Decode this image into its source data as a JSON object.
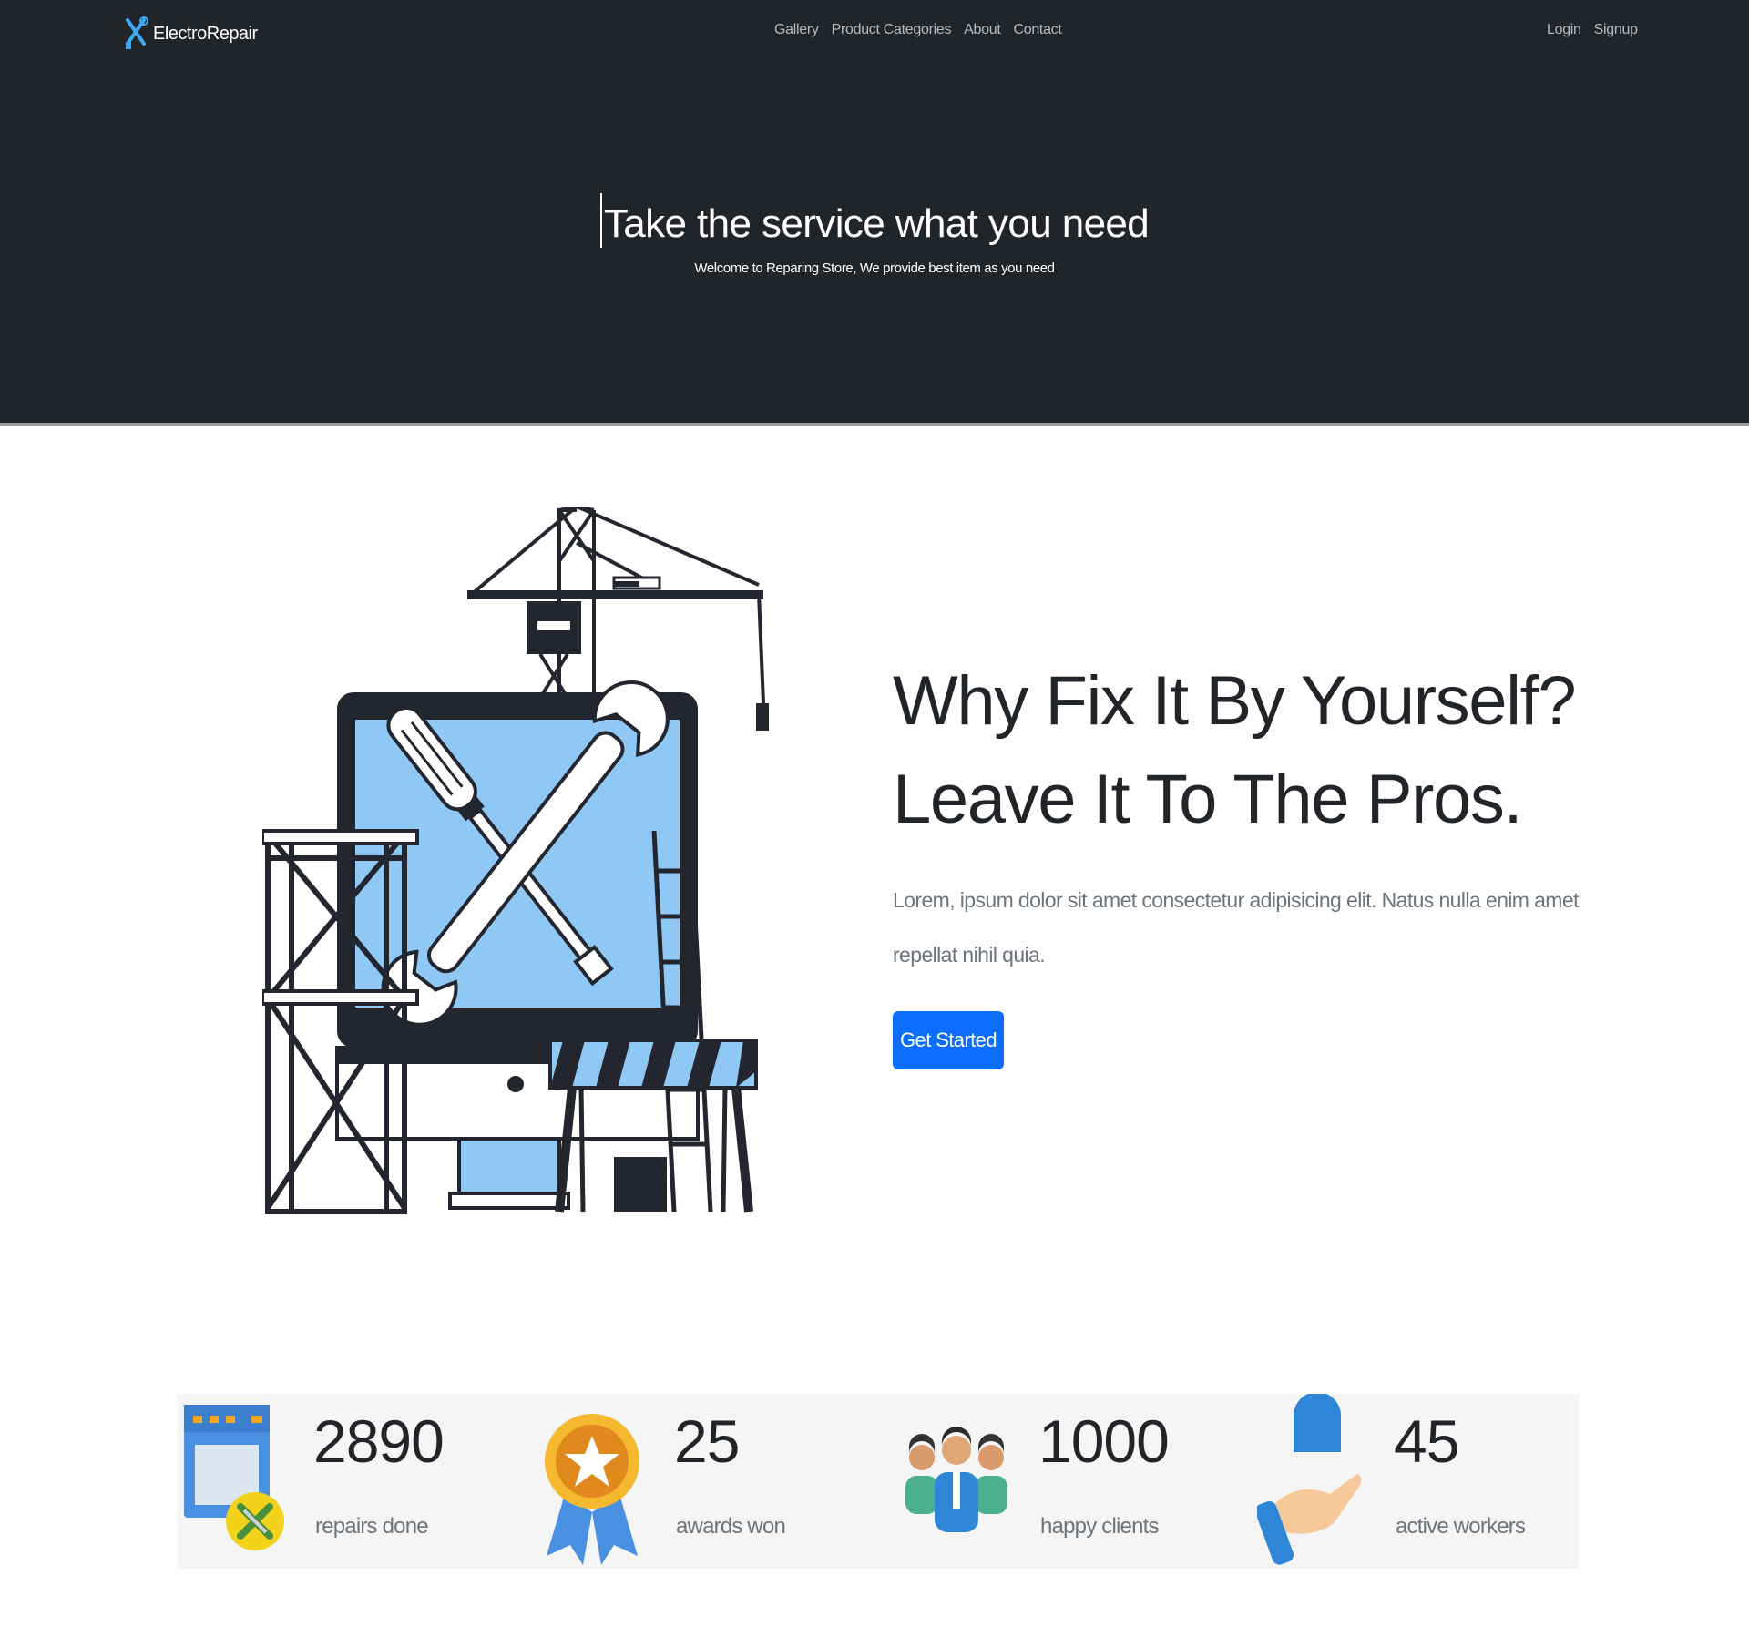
{
  "navbar": {
    "brand": "ElectroRepair",
    "links": [
      "Gallery",
      "Product Categories",
      "About",
      "Contact"
    ],
    "auth": [
      "Login",
      "Signup"
    ]
  },
  "hero": {
    "title": "Take the service what you need",
    "subtitle": "Welcome to Reparing Store, We provide best item as you need"
  },
  "feature": {
    "title": "Why Fix It By Yourself? Leave It To The Pros.",
    "text": "Lorem, ipsum dolor sit amet consectetur adipisicing elit. Natus nulla enim amet repellat nihil quia.",
    "button": "Get Started",
    "illustration_icon": "repair-illustration"
  },
  "stats": [
    {
      "value": "2890",
      "label": "repairs done",
      "icon": "repair-browser-icon"
    },
    {
      "value": "25",
      "label": "awards won",
      "icon": "award-medal-icon"
    },
    {
      "value": "1000",
      "label": "happy clients",
      "icon": "clients-group-icon"
    },
    {
      "value": "45",
      "label": "active workers",
      "icon": "worker-hand-icon"
    }
  ],
  "colors": {
    "header_bg": "#212529",
    "primary": "#0d6efd",
    "muted_text": "#6c757d",
    "stats_bg": "#f5f5f5",
    "illustration_blue": "#90c8f5",
    "brand_icon": "#3fa9f5"
  }
}
